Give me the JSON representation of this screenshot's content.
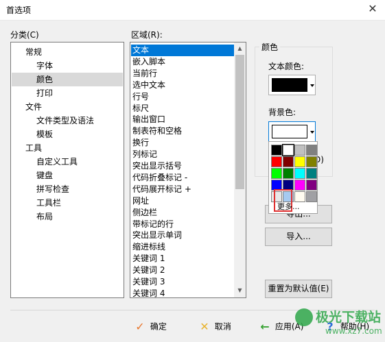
{
  "window": {
    "title": "首选项",
    "close_label": "✕"
  },
  "category": {
    "label": "分类(C)",
    "items": [
      {
        "label": "常规",
        "level": 0,
        "selected": false
      },
      {
        "label": "字体",
        "level": 1,
        "selected": false
      },
      {
        "label": "颜色",
        "level": 1,
        "selected": true
      },
      {
        "label": "打印",
        "level": 1,
        "selected": false
      },
      {
        "label": "文件",
        "level": 0,
        "selected": false
      },
      {
        "label": "文件类型及语法",
        "level": 1,
        "selected": false
      },
      {
        "label": "模板",
        "level": 1,
        "selected": false
      },
      {
        "label": "工具",
        "level": 0,
        "selected": false
      },
      {
        "label": "自定义工具",
        "level": 1,
        "selected": false
      },
      {
        "label": "键盘",
        "level": 1,
        "selected": false
      },
      {
        "label": "拼写检查",
        "level": 1,
        "selected": false
      },
      {
        "label": "工具栏",
        "level": 1,
        "selected": false
      },
      {
        "label": "布局",
        "level": 1,
        "selected": false
      }
    ]
  },
  "region": {
    "label": "区域(R):",
    "items": [
      "文本",
      "嵌入脚本",
      "当前行",
      "选中文本",
      "行号",
      "标尺",
      "输出窗口",
      "制表符和空格",
      "换行",
      "列标记",
      "突出显示括号",
      "代码折叠标记 -",
      "代码展开标记 +",
      "网址",
      "侧边栏",
      "带标记的行",
      "突出显示单词",
      "缩进标线",
      "关键词 1",
      "关键词 2",
      "关键词 3",
      "关键词 4"
    ],
    "selected_index": 0,
    "scroll_up": "▲",
    "scroll_down": "▼"
  },
  "color_group": {
    "title": "颜色",
    "text_color_label": "文本颜色:",
    "text_color_value": "#000000",
    "bg_color_label": "背景色:",
    "bg_color_value": "#ffffff",
    "partial_label": "D)"
  },
  "palette": {
    "colors": [
      "#000000",
      "#ffffff",
      "#c0c0c0",
      "#808080",
      "#ff0000",
      "#800000",
      "#ffff00",
      "#808000",
      "#00ff00",
      "#008000",
      "#00ffff",
      "#008080",
      "#0000ff",
      "#000080",
      "#ff00ff",
      "#800080",
      "#e8e8e8",
      "#a6caf0",
      "#fffbf0",
      "#a0a0a4"
    ],
    "more_label": "更多...",
    "highlight_color": "#e03030"
  },
  "buttons": {
    "export_label": "导出...",
    "import_label": "导入...",
    "reset_label": "重置为默认值(E)"
  },
  "footer": {
    "ok_label": "确定",
    "cancel_label": "取消",
    "apply_label": "应用(A)",
    "help_label": "帮助(H)",
    "ok_icon_color": "#e8772e",
    "cancel_icon_color": "#e8b32e",
    "apply_icon_color": "#3aa335",
    "help_icon_color": "#2e6fd8"
  },
  "watermark": {
    "line1": "极光下载站",
    "line2": "www.xz7.com"
  }
}
